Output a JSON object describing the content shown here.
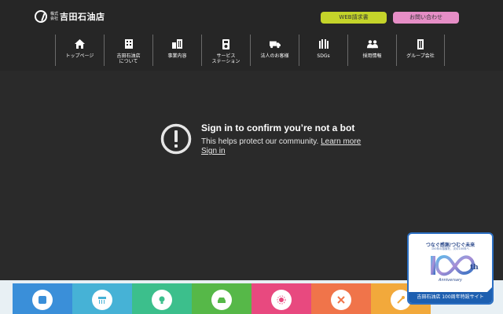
{
  "header": {
    "logo_small": "株式会社",
    "logo_text": "吉田石油店",
    "web_button": "WEB請求書",
    "contact_button": "お問い合わせ"
  },
  "nav": {
    "items": [
      {
        "label": "トップページ",
        "icon": "home-icon"
      },
      {
        "label": "吉田石油店\nについて",
        "icon": "building-icon"
      },
      {
        "label": "事業内容",
        "icon": "office-buildings-icon"
      },
      {
        "label": "サービス\nステーション",
        "icon": "fuel-pump-icon"
      },
      {
        "label": "法人のお客様",
        "icon": "truck-icon"
      },
      {
        "label": "SDGs",
        "icon": "sdgs-icon"
      },
      {
        "label": "採用情報",
        "icon": "people-icon"
      },
      {
        "label": "グループ会社",
        "icon": "tower-icon"
      }
    ]
  },
  "botcheck": {
    "title": "Sign in to confirm you’re not a bot",
    "description": "This helps protect our community.",
    "learn_more": "Learn more",
    "sign_in": "Sign in"
  },
  "tiles": [
    {
      "color": "#3a8fd9",
      "icon": "fuel-card-icon"
    },
    {
      "color": "#46b2d6",
      "icon": "car-wash-icon"
    },
    {
      "color": "#3cbf8c",
      "icon": "bulb-icon"
    },
    {
      "color": "#56b848",
      "icon": "car-icon"
    },
    {
      "color": "#e8497f",
      "icon": "sun-icon"
    },
    {
      "color": "#f0744a",
      "icon": "tools-icon"
    },
    {
      "color": "#f2a93b",
      "icon": "wrench-icon"
    }
  ],
  "anniversary": {
    "tagline": "つなぐ感謝/つむぐ未来",
    "subtagline": "100年の感謝を、次の100年へ",
    "mark": "th",
    "label": "Anniversary",
    "banner": "吉田石油店 100周年特設サイト"
  }
}
